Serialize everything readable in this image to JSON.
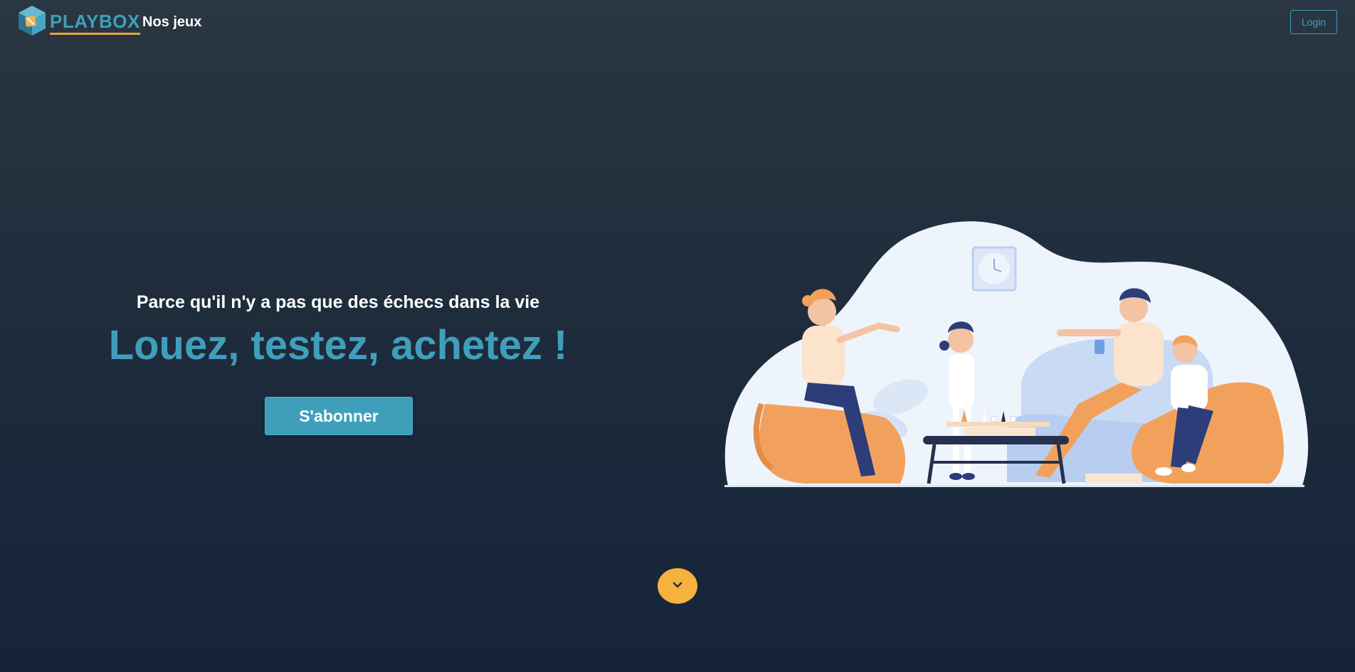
{
  "colors": {
    "accent": "#3f9fbb",
    "scroll_button": "#f6b23c",
    "background_top": "#2a3742",
    "background_bottom": "#15243a"
  },
  "header": {
    "logo_text": "PLAYBOX",
    "logo_icon": "dice-cube-icon",
    "nav_link": "Nos jeux",
    "login_label": "Login"
  },
  "hero": {
    "tagline": "Parce qu'il n'y a pas que des échecs dans la vie",
    "headline": "Louez, testez, achetez !",
    "cta_label": "S'abonner",
    "illustration": "family-board-game-illustration"
  },
  "scroll_button": {
    "icon": "chevron-down-icon"
  }
}
